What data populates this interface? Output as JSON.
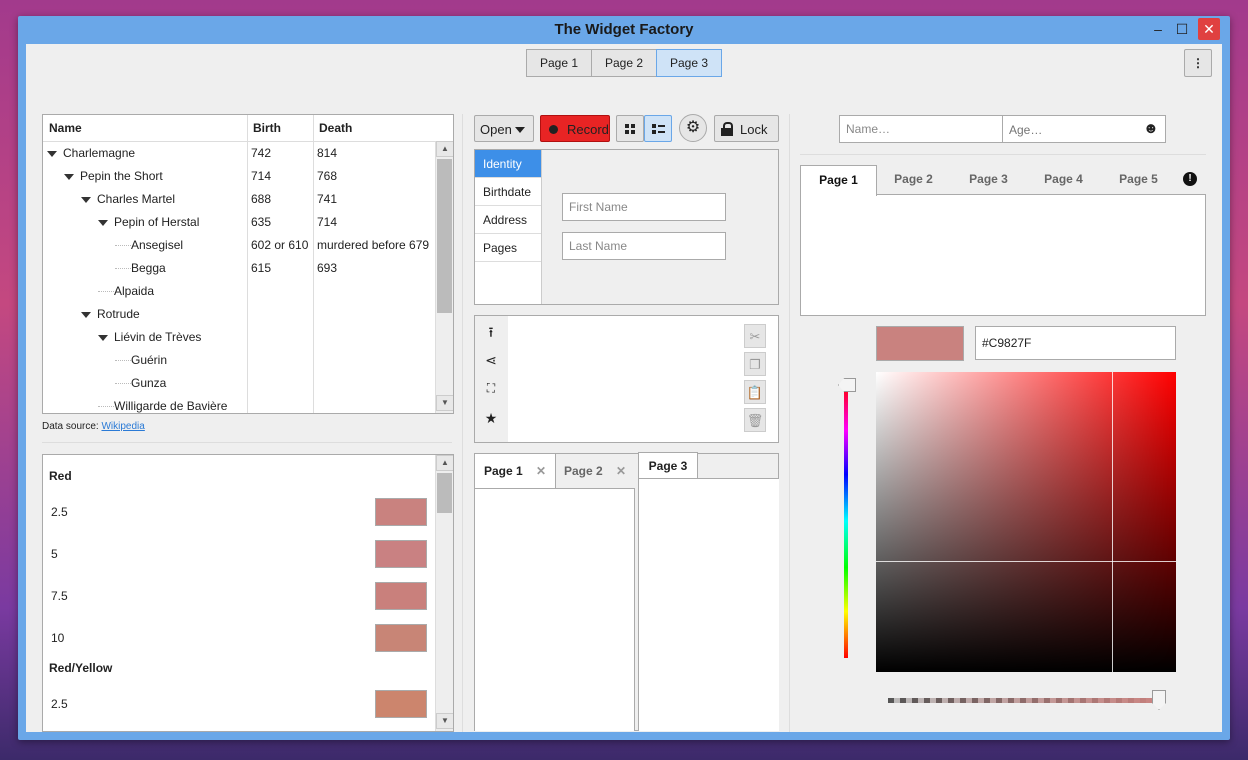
{
  "window": {
    "title": "The Widget Factory",
    "close": "✕",
    "maximize": "☐",
    "minimize": "–"
  },
  "top_tabs": [
    "Page 1",
    "Page 2",
    "Page 3"
  ],
  "top_tabs_active": 2,
  "menu_button": "⋮",
  "tree": {
    "columns": [
      "Name",
      "Birth",
      "Death"
    ],
    "rows": [
      {
        "name": "Charlemagne",
        "birth": "742",
        "death": "814",
        "depth": 0,
        "expander": true
      },
      {
        "name": "Pepin the Short",
        "birth": "714",
        "death": "768",
        "depth": 1,
        "expander": true
      },
      {
        "name": "Charles Martel",
        "birth": "688",
        "death": "741",
        "depth": 2,
        "expander": true
      },
      {
        "name": "Pepin of Herstal",
        "birth": "635",
        "death": "714",
        "depth": 3,
        "expander": true
      },
      {
        "name": "Ansegisel",
        "birth": "602 or 610",
        "death": "murdered before 679",
        "depth": 4,
        "expander": false
      },
      {
        "name": "Begga",
        "birth": "615",
        "death": "693",
        "depth": 4,
        "expander": false
      },
      {
        "name": "Alpaida",
        "birth": "",
        "death": "",
        "depth": 3,
        "expander": false
      },
      {
        "name": "Rotrude",
        "birth": "",
        "death": "",
        "depth": 2,
        "expander": true
      },
      {
        "name": "Liévin de Trèves",
        "birth": "",
        "death": "",
        "depth": 3,
        "expander": true
      },
      {
        "name": "Guérin",
        "birth": "",
        "death": "",
        "depth": 4,
        "expander": false
      },
      {
        "name": "Gunza",
        "birth": "",
        "death": "",
        "depth": 4,
        "expander": false
      },
      {
        "name": "Willigarde de Bavière",
        "birth": "",
        "death": "",
        "depth": 3,
        "expander": false
      }
    ]
  },
  "data_source": {
    "label": "Data source:",
    "link": "Wikipedia"
  },
  "swatches": {
    "groups": [
      {
        "title": "Red",
        "items": [
          {
            "label": "2.5",
            "color": "#c9827f"
          },
          {
            "label": "5",
            "color": "#c98182"
          },
          {
            "label": "7.5",
            "color": "#c9807c"
          },
          {
            "label": "10",
            "color": "#c88576"
          }
        ]
      },
      {
        "title": "Red/Yellow",
        "items": [
          {
            "label": "2.5",
            "color": "#cc856d"
          }
        ]
      }
    ]
  },
  "toolbar": {
    "open": "Open",
    "record": "Record",
    "lock": "Lock"
  },
  "sidebar": {
    "items": [
      "Identity",
      "Birthdate",
      "Address",
      "Pages"
    ],
    "active": 0
  },
  "form": {
    "first_name_placeholder": "First Name",
    "last_name_placeholder": "Last Name"
  },
  "notebook": {
    "tabs": [
      "Page 1",
      "Page 2",
      "Page 3"
    ],
    "close_glyph": "✕"
  },
  "right": {
    "name_placeholder": "Name…",
    "age_placeholder": "Age…",
    "tabs": [
      "Page 1",
      "Page 2",
      "Page 3",
      "Page 4",
      "Page 5"
    ],
    "tabs_active": 0,
    "hex_value": "#C9827F",
    "swatch_color": "#c9827f",
    "hue_fraction": 0.0,
    "alpha_fraction": 1.0
  },
  "colors": {
    "accent": "#3d8fe8",
    "record": "#e82424",
    "window_frame": "#6aa7e8"
  }
}
